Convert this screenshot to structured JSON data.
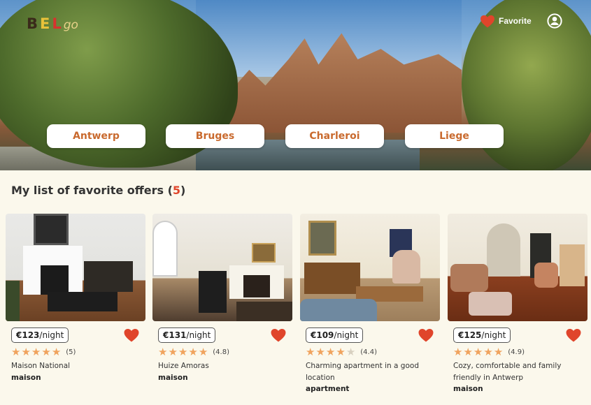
{
  "logo": {
    "b": "B",
    "e": "E",
    "l": "L",
    "go": "go"
  },
  "header": {
    "favorite_label": "Favorite"
  },
  "cities": [
    "Antwerp",
    "Bruges",
    "Charleroi",
    "Liege"
  ],
  "favorites": {
    "heading": "My list of favorite offers",
    "count": "5",
    "offers": [
      {
        "price": "€123",
        "per": "/night",
        "stars": 5,
        "rating": "(5)",
        "title": "Maison National",
        "type": "maison"
      },
      {
        "price": "€131",
        "per": "/night",
        "stars": 4.8,
        "rating": "(4.8)",
        "title": "Huize Amoras",
        "type": "maison"
      },
      {
        "price": "€109",
        "per": "/night",
        "stars": 4.4,
        "rating": "(4.4)",
        "title": "Charming apartment in a good location",
        "type": "apartment"
      },
      {
        "price": "€125",
        "per": "/night",
        "stars": 4.9,
        "rating": "(4.9)",
        "title": "Cozy, comfortable and family friendly in Antwerp",
        "type": "maison"
      }
    ]
  },
  "colors": {
    "accent": "#c96a2e",
    "heart": "#e0452b",
    "star": "#f0a35e",
    "background": "#fbf8ec"
  },
  "icons": {
    "heart": "heart-icon",
    "user": "user-circle-icon",
    "star": "star-icon"
  }
}
